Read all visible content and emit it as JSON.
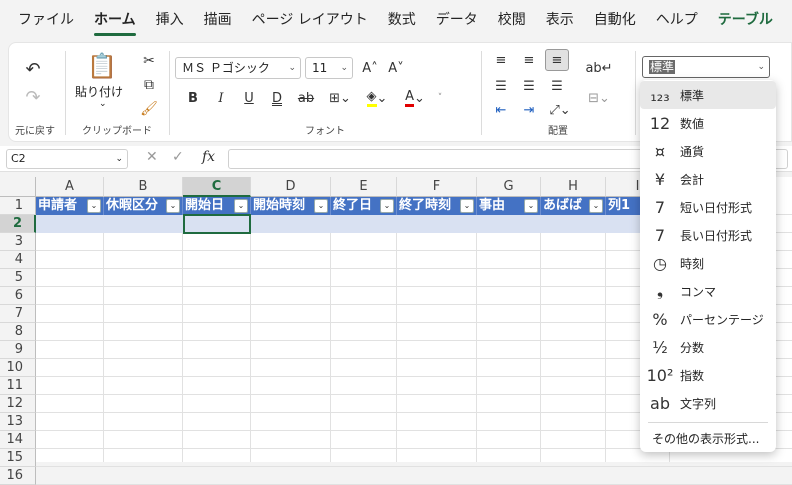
{
  "tabs": [
    "ファイル",
    "ホーム",
    "挿入",
    "描画",
    "ページ レイアウト",
    "数式",
    "データ",
    "校閲",
    "表示",
    "自動化",
    "ヘルプ",
    "テーブル"
  ],
  "ribbon": {
    "undo_group_label": "元に戻す",
    "clipboard": {
      "paste_label": "貼り付け",
      "group_label": "クリップボード"
    },
    "font": {
      "name": "ＭＳ Ｐゴシック",
      "size": "11",
      "group_label": "フォント"
    },
    "alignment": {
      "group_label": "配置"
    },
    "number": {
      "format": "標準"
    }
  },
  "formula_bar": {
    "name_box": "C2",
    "fx": "fx"
  },
  "grid": {
    "columns": [
      "A",
      "B",
      "C",
      "D",
      "E",
      "F",
      "G",
      "H",
      "I"
    ],
    "rows": [
      "1",
      "2",
      "3",
      "4",
      "5",
      "6",
      "7",
      "8",
      "9",
      "10",
      "11",
      "12",
      "13",
      "14",
      "15",
      "16"
    ],
    "headers": [
      "申請者",
      "休暇区分",
      "開始日",
      "開始時刻",
      "終了日",
      "終了時刻",
      "事由",
      "あばば",
      "列1"
    ],
    "active_cell": "C2"
  },
  "number_menu": {
    "items": [
      {
        "label": "標準",
        "icon": "general-format-icon"
      },
      {
        "label": "数値",
        "icon": "number-format-icon"
      },
      {
        "label": "通貨",
        "icon": "currency-format-icon"
      },
      {
        "label": "会計",
        "icon": "accounting-format-icon"
      },
      {
        "label": "短い日付形式",
        "icon": "short-date-icon"
      },
      {
        "label": "長い日付形式",
        "icon": "long-date-icon"
      },
      {
        "label": "時刻",
        "icon": "time-icon"
      },
      {
        "label": "コンマ",
        "icon": "comma-icon"
      },
      {
        "label": "パーセンテージ",
        "icon": "percent-icon"
      },
      {
        "label": "分数",
        "icon": "fraction-icon"
      },
      {
        "label": "指数",
        "icon": "scientific-icon"
      },
      {
        "label": "文字列",
        "icon": "text-format-icon"
      }
    ],
    "icon_glyphs": [
      "₁₂₃",
      "12",
      "¤",
      "¥",
      "7",
      "7",
      "◷",
      "❟",
      "%",
      "½",
      "10²",
      "ab"
    ],
    "more_formats": "その他の表示形式..."
  }
}
